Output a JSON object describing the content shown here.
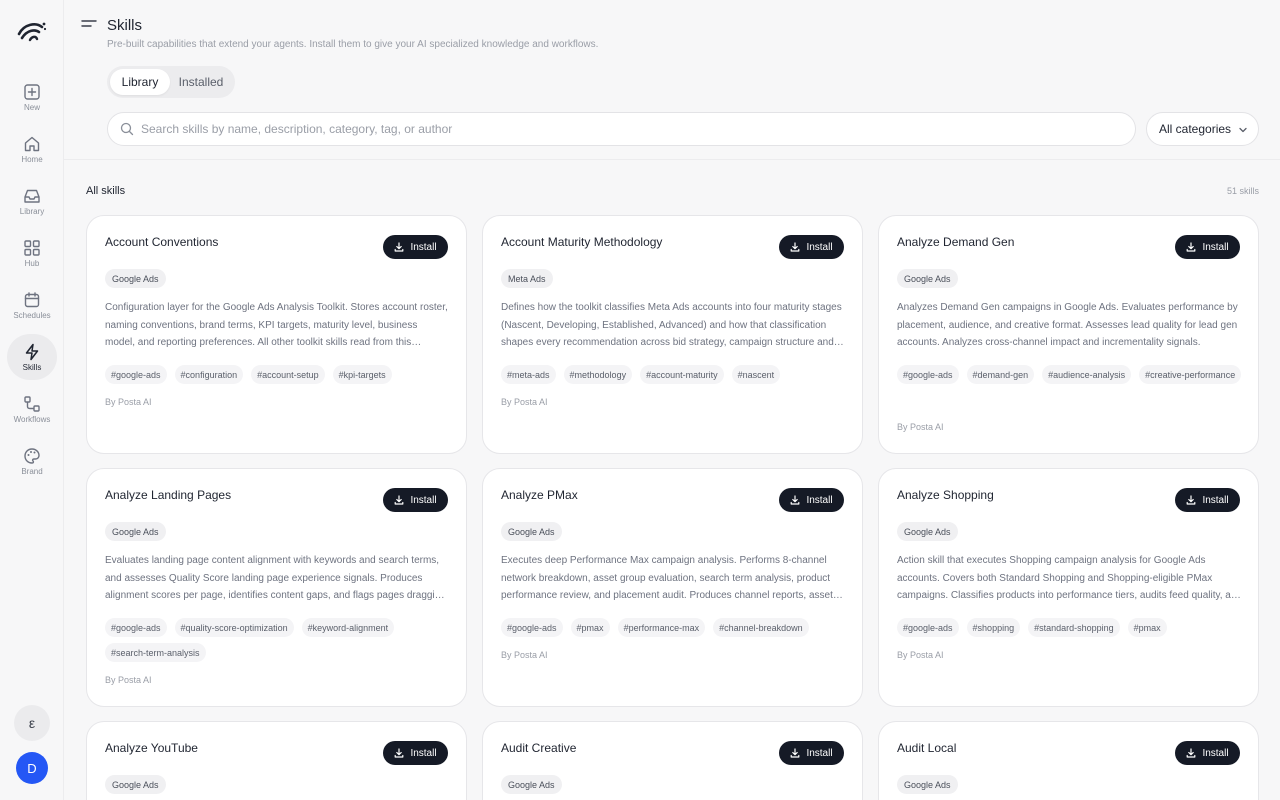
{
  "sidebar": {
    "items": [
      {
        "label": "New",
        "icon": "plus-square-icon",
        "active": false
      },
      {
        "label": "Home",
        "icon": "home-icon",
        "active": false
      },
      {
        "label": "Library",
        "icon": "inbox-icon",
        "active": false
      },
      {
        "label": "Hub",
        "icon": "grid-icon",
        "active": false
      },
      {
        "label": "Schedules",
        "icon": "calendar-icon",
        "active": false
      },
      {
        "label": "Skills",
        "icon": "lightning-icon",
        "active": true
      },
      {
        "label": "Workflows",
        "icon": "workflow-icon",
        "active": false
      },
      {
        "label": "Brand",
        "icon": "palette-icon",
        "active": false
      }
    ],
    "bottom_chip": "ε",
    "avatar_initial": "D"
  },
  "header": {
    "title": "Skills",
    "subtitle": "Pre-built capabilities that extend your agents. Install them to give your AI specialized knowledge and workflows."
  },
  "tabs": [
    {
      "label": "Library",
      "active": true
    },
    {
      "label": "Installed",
      "active": false
    }
  ],
  "search": {
    "placeholder": "Search skills by name, description, category, tag, or author",
    "value": ""
  },
  "category_filter": {
    "selected": "All categories"
  },
  "section": {
    "title": "All skills",
    "count": "51 skills"
  },
  "install_label": "Install",
  "skills": [
    {
      "title": "Account Conventions",
      "platform": "Google Ads",
      "description": "Configuration layer for the Google Ads Analysis Toolkit. Stores account roster, naming conventions, brand terms, KPI targets, maturity level, business model, and reporting preferences. All other toolkit skills read from this configuration.",
      "tags": [
        "#google-ads",
        "#configuration",
        "#account-setup",
        "#kpi-targets"
      ],
      "author": "By Posta AI"
    },
    {
      "title": "Account Maturity Methodology",
      "platform": "Meta Ads",
      "description": "Defines how the toolkit classifies Meta Ads accounts into four maturity stages (Nascent, Developing, Established, Advanced) and how that classification shapes every recommendation across bid strategy, campaign structure and testing.",
      "tags": [
        "#meta-ads",
        "#methodology",
        "#account-maturity",
        "#nascent"
      ],
      "author": "By Posta AI"
    },
    {
      "title": "Analyze Demand Gen",
      "platform": "Google Ads",
      "description": "Analyzes Demand Gen campaigns in Google Ads. Evaluates performance by placement, audience, and creative format. Assesses lead quality for lead gen accounts. Analyzes cross-channel impact and incrementality signals.",
      "tags": [
        "#google-ads",
        "#demand-gen",
        "#audience-analysis",
        "#creative-performance"
      ],
      "author": "By Posta AI"
    },
    {
      "title": "Analyze Landing Pages",
      "platform": "Google Ads",
      "description": "Evaluates landing page content alignment with keywords and search terms, and assesses Quality Score landing page experience signals. Produces alignment scores per page, identifies content gaps, and flags pages dragging down Quality Score.",
      "tags": [
        "#google-ads",
        "#quality-score-optimization",
        "#keyword-alignment",
        "#search-term-analysis"
      ],
      "author": "By Posta AI"
    },
    {
      "title": "Analyze PMax",
      "platform": "Google Ads",
      "description": "Executes deep Performance Max campaign analysis. Performs 8-channel network breakdown, asset group evaluation, search term analysis, product performance review, and placement audit. Produces channel reports, asset ratings and recommendations.",
      "tags": [
        "#google-ads",
        "#pmax",
        "#performance-max",
        "#channel-breakdown"
      ],
      "author": "By Posta AI"
    },
    {
      "title": "Analyze Shopping",
      "platform": "Google Ads",
      "description": "Action skill that executes Shopping campaign analysis for Google Ads accounts. Covers both Standard Shopping and Shopping-eligible PMax campaigns. Classifies products into performance tiers, audits feed quality, and identifies wasted spend.",
      "tags": [
        "#google-ads",
        "#shopping",
        "#standard-shopping",
        "#pmax"
      ],
      "author": "By Posta AI"
    },
    {
      "title": "Analyze YouTube",
      "platform": "Google Ads",
      "description": "",
      "tags": [],
      "author": ""
    },
    {
      "title": "Audit Creative",
      "platform": "Google Ads",
      "description": "",
      "tags": [],
      "author": ""
    },
    {
      "title": "Audit Local",
      "platform": "Google Ads",
      "description": "",
      "tags": [],
      "author": ""
    }
  ]
}
